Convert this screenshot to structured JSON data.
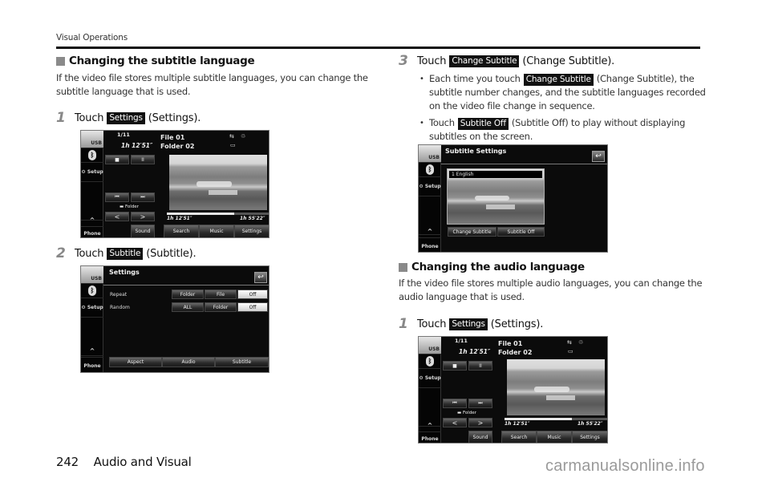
{
  "page": {
    "running_head": "Visual Operations",
    "footer_page_number": "242",
    "footer_section": "Audio and Visual",
    "watermark": "carmanualsonline.info"
  },
  "left_column": {
    "section_title": "Changing the subtitle language",
    "intro_line1": "If the video file stores multiple subtitle languages, you can change the",
    "intro_line2": "subtitle language that is used.",
    "step1": {
      "number": "1",
      "prefix": "Touch",
      "key": "Settings",
      "suffix": "(Settings)."
    },
    "step2": {
      "number": "2",
      "prefix": "Touch",
      "key": "Subtitle",
      "suffix": "(Subtitle)."
    }
  },
  "right_column": {
    "step3": {
      "number": "3",
      "prefix": "Touch",
      "key": "Change Subtitle",
      "suffix": "(Change Subtitle)."
    },
    "bullet1": {
      "prefix": "Each time you touch",
      "key": "Change Subtitle",
      "line1_suffix": "(Change Subtitle), the",
      "line2": "subtitle number changes, and the subtitle languages recorded",
      "line3": "on the video file change in sequence."
    },
    "bullet2": {
      "prefix": "Touch",
      "key": "Subtitle Off",
      "line1_suffix": "(Subtitle Off) to play without displaying",
      "line2": "subtitles on the screen."
    },
    "section_title": "Changing the audio language",
    "intro_line1": "If the video file stores multiple audio languages, you can change the",
    "intro_line2": "audio language that is used.",
    "step1": {
      "number": "1",
      "prefix": "Touch",
      "key": "Settings",
      "suffix": "(Settings)."
    }
  },
  "screens": {
    "sidebar": {
      "usb": "USB",
      "setup": "Setup",
      "up": "^",
      "phone": "Phone"
    },
    "player": {
      "track": "1/11",
      "elapsed_top": "1h 12′51″",
      "file": "File 01",
      "folder": "Folder 02",
      "folder_label": "Folder",
      "elapsed": "1h 12′51″",
      "total": "1h 55′22″",
      "progress": 0.66,
      "buttons": {
        "stop": "■",
        "pause": "II",
        "prev": "⏮",
        "next": "⏭",
        "left": "<",
        "right": ">",
        "sound": "Sound",
        "search": "Search",
        "music": "Music",
        "settings": "Settings"
      }
    },
    "settings": {
      "title": "Settings",
      "repeat_label": "Repeat",
      "repeat_options": [
        "Folder",
        "File",
        "Off"
      ],
      "repeat_selected": "Off",
      "random_label": "Random",
      "random_options": [
        "ALL",
        "Folder",
        "Off"
      ],
      "random_selected": "Off",
      "bottom_buttons": [
        "Aspect",
        "Audio",
        "Subtitle"
      ]
    },
    "subtitle_settings": {
      "title": "Subtitle Settings",
      "current_subtitle": "1 English",
      "change_button": "Change Subtitle",
      "off_button": "Subtitle Off"
    }
  }
}
